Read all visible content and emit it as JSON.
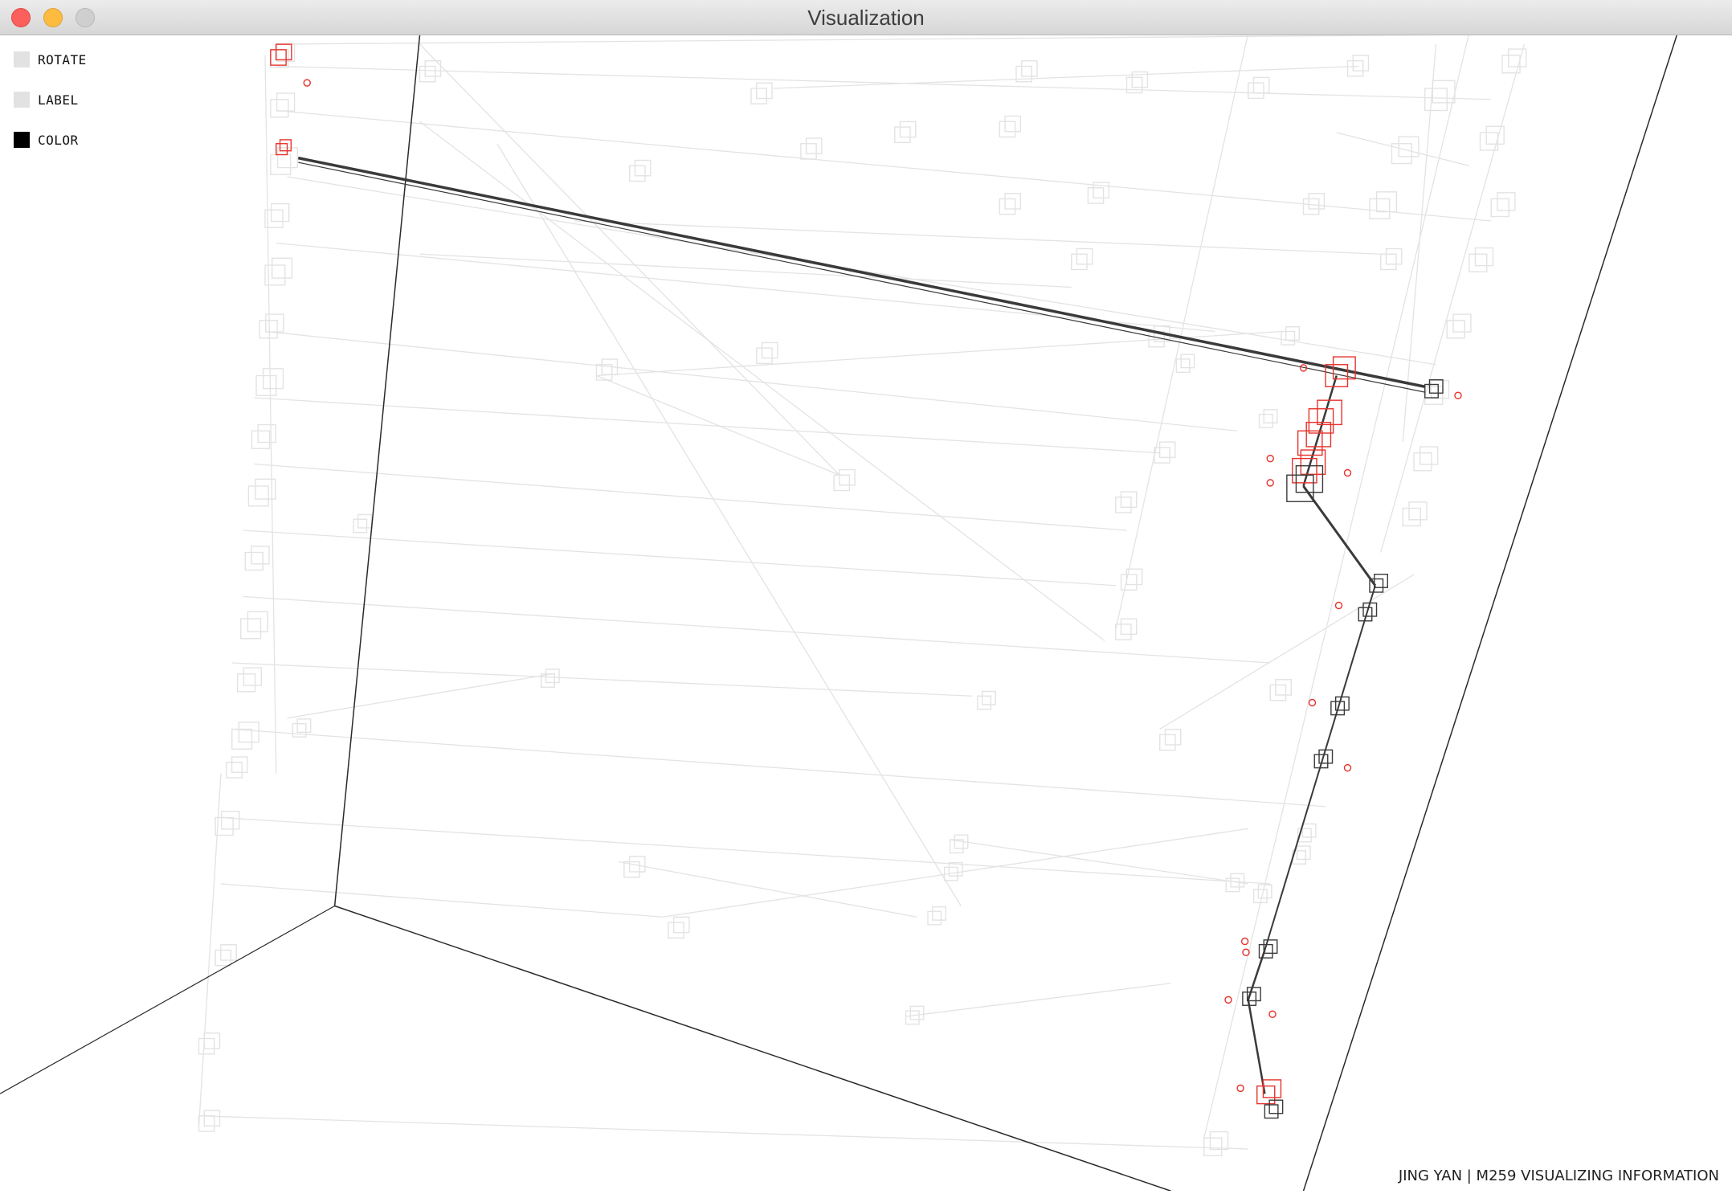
{
  "window": {
    "title": "Visualization"
  },
  "controls": [
    {
      "label": "ROTATE",
      "checked": false
    },
    {
      "label": "LABEL",
      "checked": false
    },
    {
      "label": "COLOR",
      "checked": true
    }
  ],
  "footer": {
    "credit": "JING YAN | M259 VISUALIZING INFORMATION"
  },
  "colors": {
    "faint": "#e3e3e3",
    "dark": "#3a3a3a",
    "highlight": "#e8322c",
    "frame": "#2a2a2a"
  }
}
